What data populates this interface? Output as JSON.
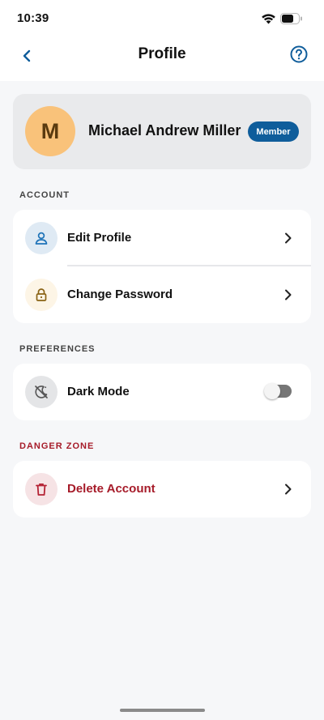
{
  "status_bar": {
    "time": "10:39"
  },
  "nav": {
    "title": "Profile"
  },
  "profile": {
    "initial": "M",
    "name": "Michael Andrew Miller",
    "badge": "Member"
  },
  "sections": {
    "account": {
      "header": "ACCOUNT",
      "items": [
        {
          "label": "Edit Profile",
          "icon": "user-icon"
        },
        {
          "label": "Change Password",
          "icon": "lock-icon"
        }
      ]
    },
    "preferences": {
      "header": "PREFERENCES",
      "items": [
        {
          "label": "Dark Mode",
          "icon": "moon-slash-icon",
          "toggle_on": false
        }
      ]
    },
    "danger": {
      "header": "DANGER ZONE",
      "items": [
        {
          "label": "Delete Account",
          "icon": "trash-icon"
        }
      ]
    }
  },
  "colors": {
    "accent": "#0f5d9b",
    "danger": "#a61b29",
    "avatar_bg": "#f9c27a",
    "background": "#f6f7f9"
  }
}
